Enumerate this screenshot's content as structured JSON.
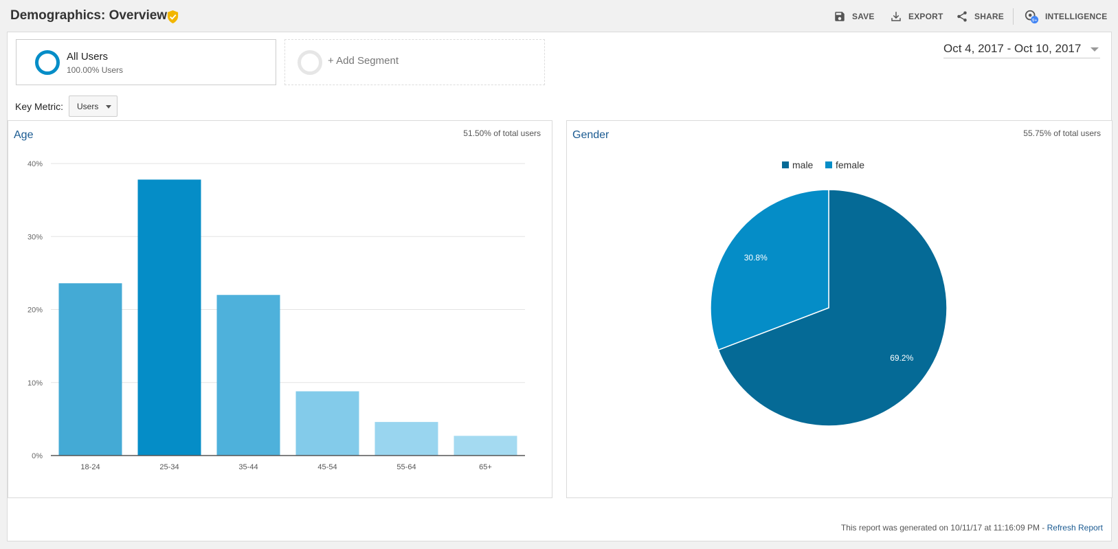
{
  "header": {
    "title": "Demographics: Overview",
    "actions": [
      {
        "label": "SAVE",
        "icon": "save-icon"
      },
      {
        "label": "EXPORT",
        "icon": "download-icon"
      },
      {
        "label": "SHARE",
        "icon": "share-icon"
      },
      {
        "label": "INTELLIGENCE",
        "icon": "intelligence-icon",
        "badge": "9+"
      }
    ]
  },
  "segments": {
    "primary": {
      "name": "All Users",
      "sub": "100.00% Users"
    },
    "add_label": "+ Add Segment"
  },
  "date_range": "Oct 4, 2017 - Oct 10, 2017",
  "key_metric": {
    "label": "Key Metric:",
    "value": "Users"
  },
  "age_panel": {
    "title": "Age",
    "pct": "51.50% of total users"
  },
  "gender_panel": {
    "title": "Gender",
    "pct": "55.75% of total users"
  },
  "footer": {
    "text": "This report was generated on 10/11/17 at 11:16:09 PM - ",
    "link": "Refresh Report"
  },
  "colors": {
    "accent": "#058dc7",
    "dark": "#056a96",
    "title_blue": "#1a5a91",
    "verified": "#f2b600"
  },
  "chart_data": [
    {
      "type": "bar",
      "categories": [
        "18-24",
        "25-34",
        "35-44",
        "45-54",
        "55-64",
        "65+"
      ],
      "values": [
        23.6,
        37.8,
        22.0,
        8.8,
        4.6,
        2.7
      ],
      "bar_colors": [
        "#44aad5",
        "#058dc7",
        "#4eb1db",
        "#83cbea",
        "#99d5ef",
        "#a4daf1"
      ],
      "y_ticks": [
        "0%",
        "10%",
        "20%",
        "30%",
        "40%"
      ],
      "ylim": [
        0,
        40
      ],
      "grid": true
    },
    {
      "type": "pie",
      "labels": [
        "male",
        "female"
      ],
      "values": [
        69.2,
        30.8
      ],
      "value_labels": [
        "69.2%",
        "30.8%"
      ],
      "colors": [
        "#056a96",
        "#058dc7"
      ],
      "legend": "top"
    }
  ]
}
